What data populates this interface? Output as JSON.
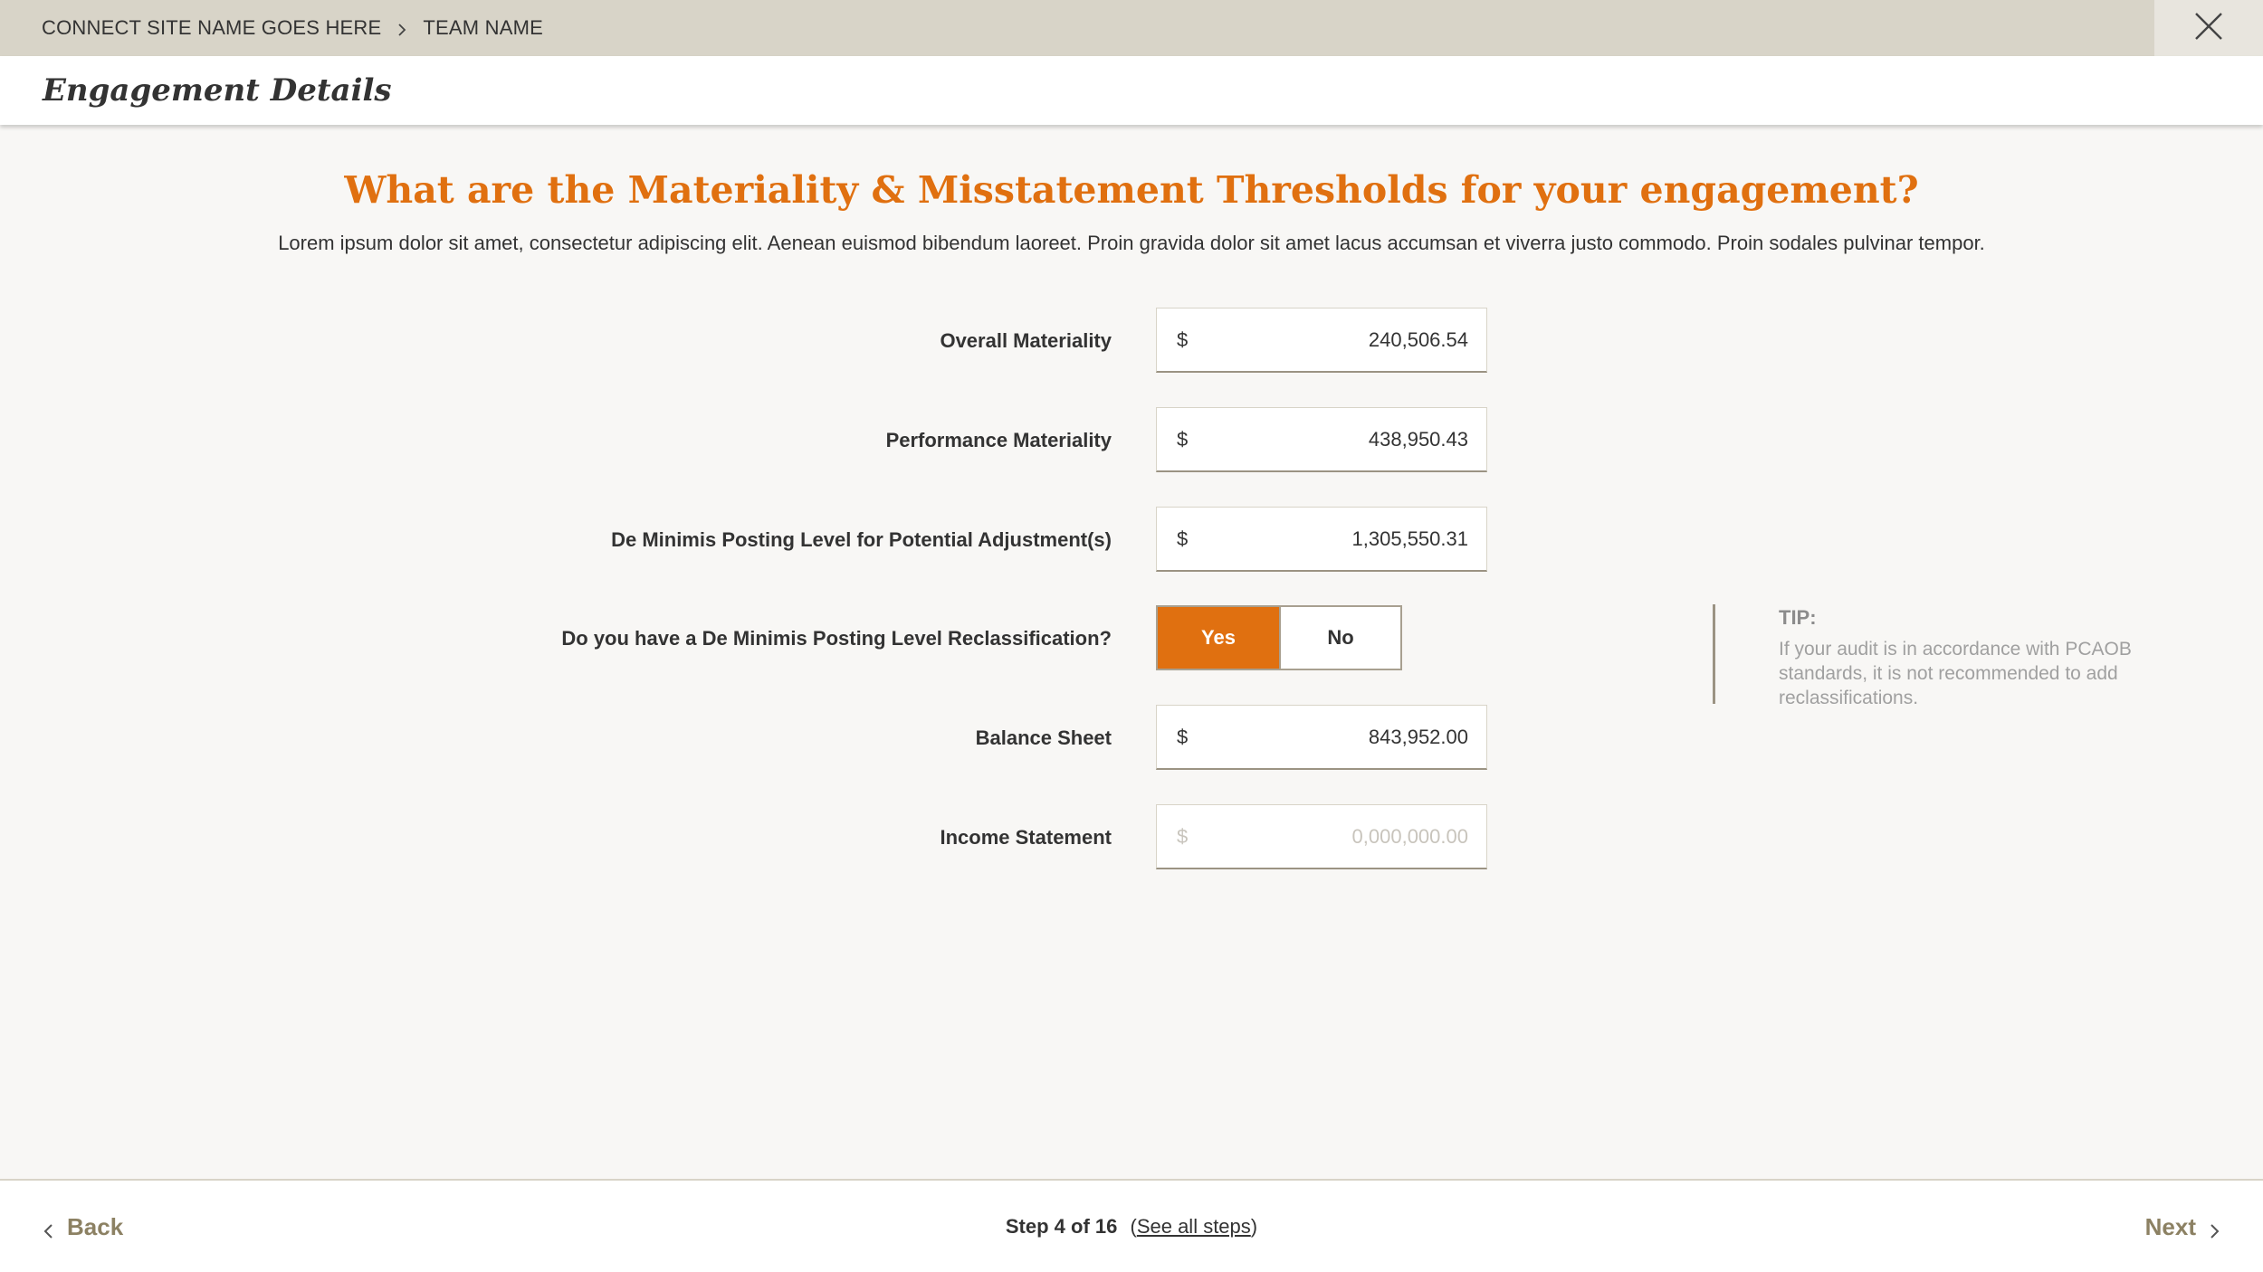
{
  "breadcrumb": {
    "site": "CONNECT SITE NAME GOES HERE",
    "team": "TEAM NAME",
    "separator_icon": "chevron-right-icon",
    "close_icon": "close-icon"
  },
  "header": {
    "title": "Engagement Details"
  },
  "main": {
    "question": "What are the Materiality & Misstatement Thresholds for your engagement?",
    "description": "Lorem ipsum dolor sit amet, consectetur adipiscing elit. Aenean euismod bibendum laoreet. Proin gravida dolor sit amet lacus accumsan et viverra justo commodo. Proin sodales pulvinar tempor.",
    "fields": {
      "overall": {
        "label": "Overall Materiality",
        "currency": "$",
        "value": "240,506.54"
      },
      "performance": {
        "label": "Performance Materiality",
        "currency": "$",
        "value": "438,950.43"
      },
      "de_minimis": {
        "label": "De Minimis Posting Level for Potential Adjustment(s)",
        "currency": "$",
        "value": "1,305,550.31"
      },
      "balance_sheet": {
        "label": "Balance Sheet",
        "currency": "$",
        "value": "843,952.00"
      },
      "income_statement": {
        "label": "Income Statement",
        "currency": "$",
        "placeholder": "0,000,000.00"
      }
    },
    "reclass_question": {
      "label": "Do you have a De Minimis Posting Level Reclassification?",
      "yes": "Yes",
      "no": "No",
      "selected": "Yes"
    },
    "tip": {
      "title": "TIP:",
      "text": "If your audit is in accordance with PCAOB standards, it is not recommended to add reclassifications."
    }
  },
  "footer": {
    "back": "Back",
    "next": "Next",
    "step": "Step 4 of 16",
    "see_all_open": "(",
    "see_all": "See all steps",
    "see_all_close": ")"
  },
  "colors": {
    "accent": "#e07010",
    "topbar": "#d8d4c8",
    "link": "#8c8163"
  }
}
